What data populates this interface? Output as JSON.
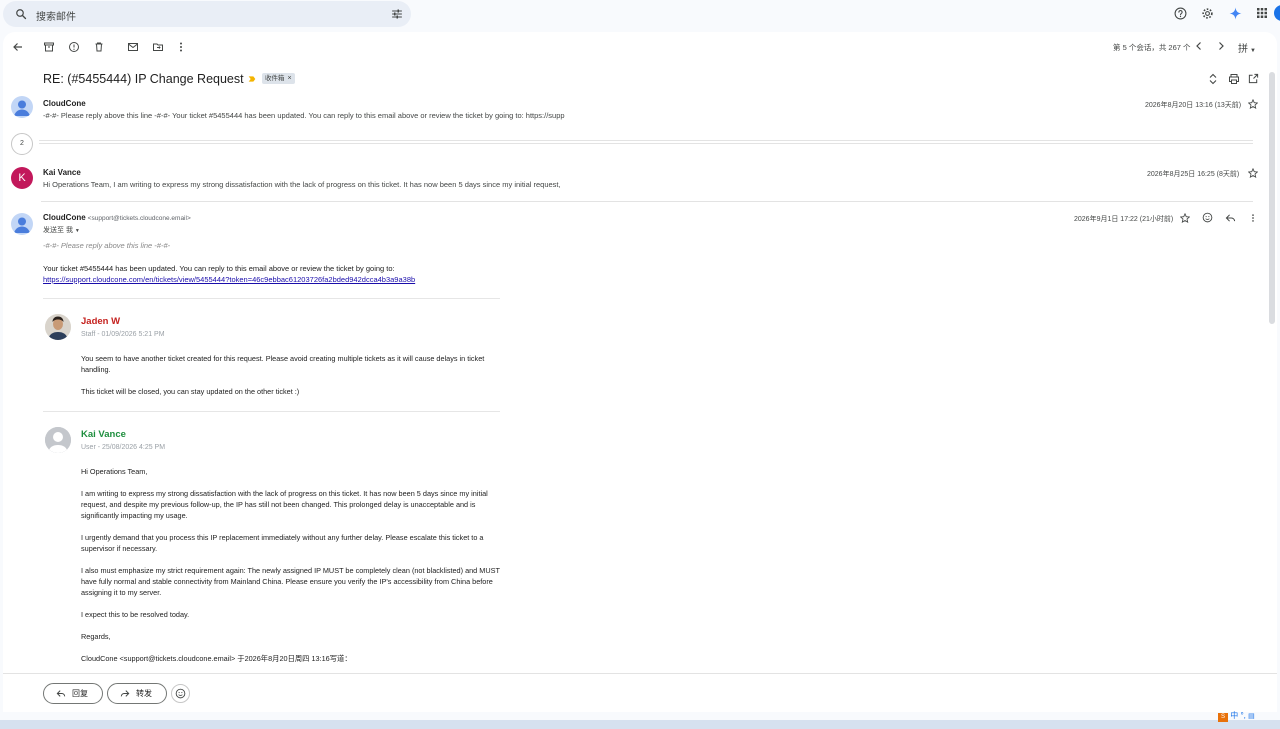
{
  "search": {
    "placeholder": "搜索邮件"
  },
  "toolbar": {
    "pager": "第 5 个会话，共 267 个",
    "ime_label": "拼"
  },
  "subject": "RE: (#5455444) IP Change Request",
  "label_chip": "收件箱",
  "label_chip_close": "×",
  "messages": {
    "m1": {
      "sender": "CloudCone",
      "snippet": "-#-#- Please reply above this line -#-#- Your ticket #5455444 has been updated. You can reply to this email above or review the ticket by going to: https://supp",
      "date": "2026年8月20日 13:16 (13天前)"
    },
    "collapsed_count": "2",
    "m2": {
      "avatar_letter": "K",
      "sender": "Kai Vance",
      "snippet": "Hi Operations Team, I am writing to express my strong dissatisfaction with the lack of progress on this ticket. It has now been 5 days since my initial request,",
      "date": "2026年8月25日 16:25 (8天前)"
    },
    "m3": {
      "sender": "CloudCone",
      "email": "<support@tickets.cloudcone.email>",
      "to": "发送至 我",
      "date": "2026年9月1日 17:22 (21小时前)",
      "quote_line": "-#-#- Please reply above this line -#-#-",
      "update_text": "Your ticket #5455444 has been updated. You can reply to this email above or review the ticket by going to:",
      "link": "https://support.cloudcone.com/en/tickets/view/5455444?token=46c9ebbac61203726fa2bded942dcca4b3a9a38b"
    }
  },
  "replies": [
    {
      "name": "Jaden W",
      "meta": "Staff - 01/09/2026 5:21 PM",
      "p1": "You seem to have another ticket created for this request. Please avoid creating multiple tickets as it will cause delays in ticket handling.",
      "p2": "This ticket will be closed, you can stay updated on the other ticket :)"
    },
    {
      "name": "Kai Vance",
      "meta": "User - 25/08/2026 4:25 PM",
      "p1": "Hi Operations Team,",
      "p2": "I am writing to express my strong dissatisfaction with the lack of progress on this ticket. It has now been 5 days since my initial request, and despite my previous follow-up, the IP has still not been changed. This prolonged delay is unacceptable and is significantly impacting my usage.",
      "p3": "I urgently demand that you process this IP replacement immediately without any further delay. Please escalate this ticket to a supervisor if necessary.",
      "p4": "I also must emphasize my strict requirement again: The newly assigned IP MUST be completely clean (not blacklisted) and MUST have fully normal and stable connectivity from Mainland China. Please ensure you verify the IP's accessibility from China before assigning it to my server.",
      "p5": "I expect this to be resolved today.",
      "p6": "Regards,",
      "p7": "CloudCone <support@tickets.cloudcone.email> 于2026年8月20日周四 13:16写道："
    }
  ],
  "actions": {
    "reply": "回复",
    "forward": "转发"
  },
  "tray": {
    "ime_mode": "中",
    "punct": "°,"
  },
  "colors": {
    "jaden_name": "#c5221f",
    "kai_name": "#1e8e3e",
    "avatar_k": "#c2185b",
    "link": "#1a0dab"
  }
}
